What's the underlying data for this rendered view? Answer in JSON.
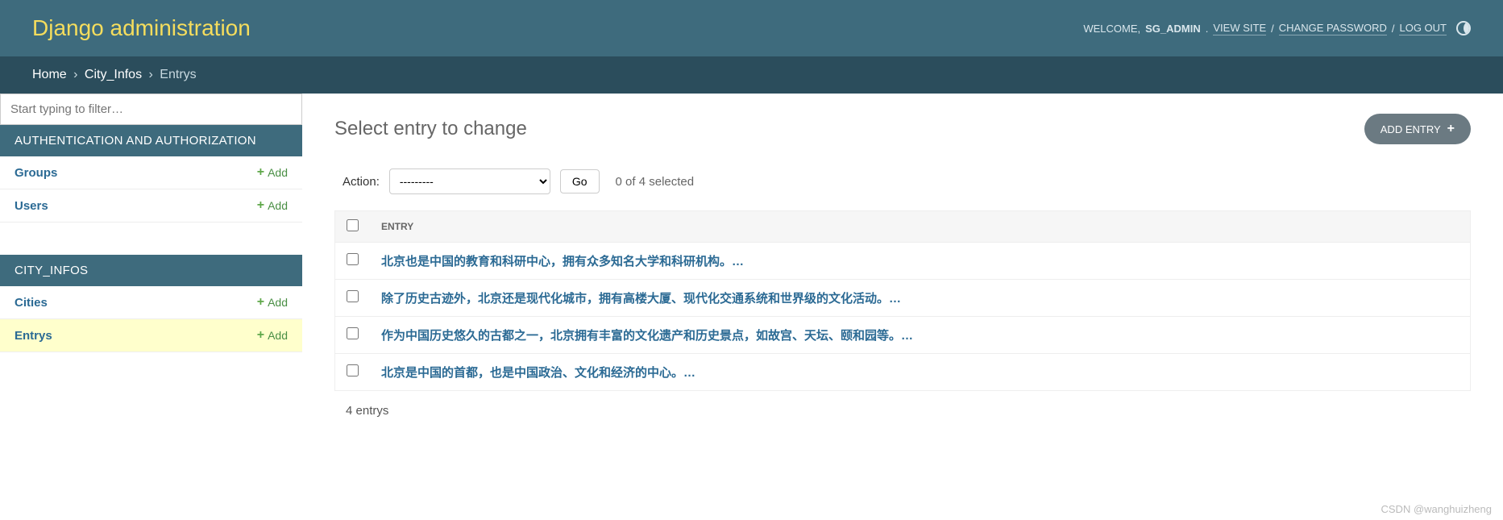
{
  "header": {
    "site_title": "Django administration",
    "welcome_text": "WELCOME,",
    "username": "SG_ADMIN",
    "view_site": "VIEW SITE",
    "change_password": "CHANGE PASSWORD",
    "log_out": "LOG OUT",
    "period": "."
  },
  "breadcrumbs": {
    "home": "Home",
    "app": "City_Infos",
    "current": "Entrys",
    "sep": "›"
  },
  "sidebar": {
    "filter_placeholder": "Start typing to filter…",
    "apps": [
      {
        "caption": "AUTHENTICATION AND AUTHORIZATION",
        "models": [
          {
            "name": "Groups",
            "add_label": "Add",
            "selected": false
          },
          {
            "name": "Users",
            "add_label": "Add",
            "selected": false
          }
        ]
      },
      {
        "caption": "CITY_INFOS",
        "models": [
          {
            "name": "Cities",
            "add_label": "Add",
            "selected": false
          },
          {
            "name": "Entrys",
            "add_label": "Add",
            "selected": true
          }
        ]
      }
    ],
    "collapse_glyph": "«"
  },
  "content": {
    "title": "Select entry to change",
    "add_button": "ADD ENTRY",
    "actions": {
      "label": "Action:",
      "placeholder_option": "---------",
      "go": "Go",
      "selection_count": "0 of 4 selected"
    },
    "columns": {
      "entry": "ENTRY"
    },
    "rows": [
      {
        "text": "北京也是中国的教育和科研中心，拥有众多知名大学和科研机构。…"
      },
      {
        "text": "除了历史古迹外，北京还是现代化城市，拥有高楼大厦、现代化交通系统和世界级的文化活动。…"
      },
      {
        "text": "作为中国历史悠久的古都之一，北京拥有丰富的文化遗产和历史景点，如故宫、天坛、颐和园等。…"
      },
      {
        "text": "北京是中国的首都，也是中国政治、文化和经济的中心。…"
      }
    ],
    "paginator": "4 entrys"
  },
  "watermark": "CSDN @wanghuizheng"
}
